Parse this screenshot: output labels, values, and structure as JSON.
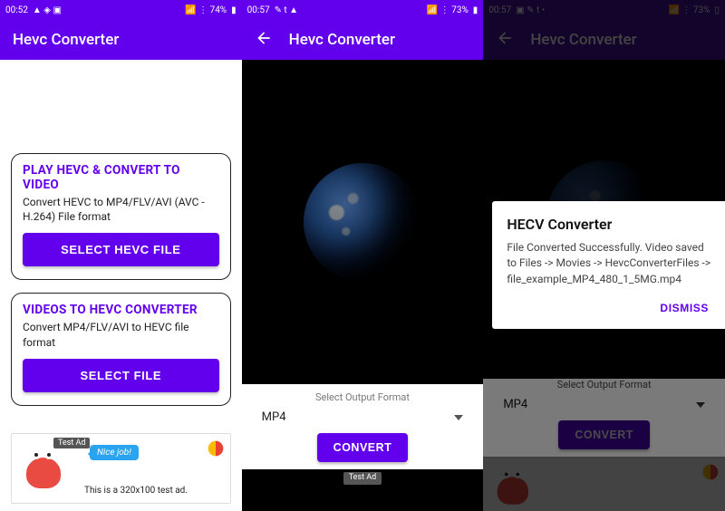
{
  "colors": {
    "primary": "#6200ee"
  },
  "screen1": {
    "status": {
      "time": "00:52",
      "left_icons": "▲ ◈ ▣",
      "right_icons": "📶 ⋮ 74%",
      "battery": "74%",
      "battery_icon": "▮"
    },
    "appbar": {
      "title": "Hevc Converter"
    },
    "card1": {
      "title": "PLAY HEVC & CONVERT TO VIDEO",
      "desc": "Convert HEVC to MP4/FLV/AVI (AVC - H.264) File format",
      "button": "SELECT HEVC FILE"
    },
    "card2": {
      "title": "VIDEOS TO HEVC CONVERTER",
      "desc": "Convert MP4/FLV/AVI to HEVC  file format",
      "button": "SELECT FILE"
    },
    "ad": {
      "badge": "Test Ad",
      "bubble": "Nice job!",
      "text": "This is a 320x100 test ad."
    }
  },
  "screen2": {
    "status": {
      "time": "00:57",
      "left_icons": "✎ t ▲",
      "right_icons": "📶 ⋮ 73%",
      "battery": "73%",
      "battery_icon": "▮"
    },
    "appbar": {
      "title": "Hevc Converter"
    },
    "format": {
      "label": "Select Output Format",
      "selected": "MP4"
    },
    "convert_button": "CONVERT",
    "ad": {
      "badge": "Test Ad"
    }
  },
  "screen3": {
    "status": {
      "time": "00:57",
      "left_icons": "▣ ✎ t •",
      "right_icons": "📶 ⋮ 73%",
      "battery": "73%",
      "battery_icon": "▯"
    },
    "appbar": {
      "title": "Hevc Converter"
    },
    "format": {
      "label": "Select Output Format",
      "selected": "MP4"
    },
    "convert_button": "CONVERT",
    "dialog": {
      "title": "HECV Converter",
      "body": "File Converted Successfully. Video saved to\nFiles -> Movies -> HevcConverterFiles -> file_example_MP4_480_1_5MG.mp4",
      "dismiss": "DISMISS"
    }
  }
}
